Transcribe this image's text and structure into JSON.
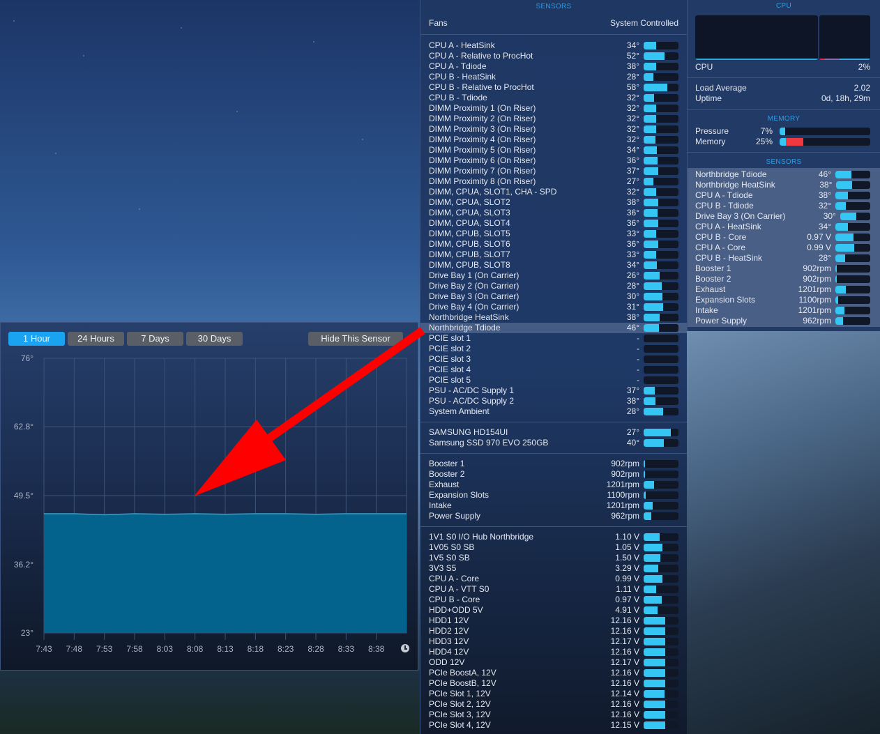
{
  "colors": {
    "accent": "#2a9de8",
    "bar_fill": "#35c6f4",
    "bar_track": "#101828",
    "memory_wired": "#f0393f",
    "arrow": "#ff0000",
    "chart_area": "#03638c"
  },
  "sensors_panel": {
    "title": "SENSORS",
    "fans_label": "Fans",
    "fans_mode": "System Controlled",
    "groups": [
      {
        "rows": [
          {
            "label": "CPU A - HeatSink",
            "value": "34°",
            "fill": 0.36
          },
          {
            "label": "CPU A - Relative to ProcHot",
            "value": "52°",
            "fill": 0.6
          },
          {
            "label": "CPU A - Tdiode",
            "value": "38°",
            "fill": 0.36
          },
          {
            "label": "CPU B - HeatSink",
            "value": "28°",
            "fill": 0.28
          },
          {
            "label": "CPU B - Relative to ProcHot",
            "value": "58°",
            "fill": 0.68
          },
          {
            "label": "CPU B - Tdiode",
            "value": "32°",
            "fill": 0.3
          },
          {
            "label": "DIMM Proximity 1 (On Riser)",
            "value": "32°",
            "fill": 0.36
          },
          {
            "label": "DIMM Proximity 2 (On Riser)",
            "value": "32°",
            "fill": 0.36
          },
          {
            "label": "DIMM Proximity 3 (On Riser)",
            "value": "32°",
            "fill": 0.36
          },
          {
            "label": "DIMM Proximity 4 (On Riser)",
            "value": "32°",
            "fill": 0.34
          },
          {
            "label": "DIMM Proximity 5 (On Riser)",
            "value": "34°",
            "fill": 0.38
          },
          {
            "label": "DIMM Proximity 6 (On Riser)",
            "value": "36°",
            "fill": 0.4
          },
          {
            "label": "DIMM Proximity 7 (On Riser)",
            "value": "37°",
            "fill": 0.42
          },
          {
            "label": "DIMM Proximity 8 (On Riser)",
            "value": "27°",
            "fill": 0.28
          },
          {
            "label": "DIMM, CPUA, SLOT1, CHA - SPD",
            "value": "32°",
            "fill": 0.36
          },
          {
            "label": "DIMM, CPUA, SLOT2",
            "value": "38°",
            "fill": 0.42
          },
          {
            "label": "DIMM, CPUA, SLOT3",
            "value": "36°",
            "fill": 0.4
          },
          {
            "label": "DIMM, CPUA, SLOT4",
            "value": "36°",
            "fill": 0.42
          },
          {
            "label": "DIMM, CPUB, SLOT5",
            "value": "33°",
            "fill": 0.36
          },
          {
            "label": "DIMM, CPUB, SLOT6",
            "value": "36°",
            "fill": 0.42
          },
          {
            "label": "DIMM, CPUB, SLOT7",
            "value": "33°",
            "fill": 0.36
          },
          {
            "label": "DIMM, CPUB, SLOT8",
            "value": "34°",
            "fill": 0.38
          },
          {
            "label": "Drive Bay 1 (On Carrier)",
            "value": "26°",
            "fill": 0.46
          },
          {
            "label": "Drive Bay 2 (On Carrier)",
            "value": "28°",
            "fill": 0.52
          },
          {
            "label": "Drive Bay 3 (On Carrier)",
            "value": "30°",
            "fill": 0.54
          },
          {
            "label": "Drive Bay 4 (On Carrier)",
            "value": "31°",
            "fill": 0.56
          },
          {
            "label": "Northbridge HeatSink",
            "value": "38°",
            "fill": 0.46
          },
          {
            "label": "Northbridge Tdiode",
            "value": "46°",
            "fill": 0.44,
            "selected": true
          },
          {
            "label": "PCIE slot 1",
            "value": "-",
            "fill": 0
          },
          {
            "label": "PCIE slot 2",
            "value": "-",
            "fill": 0
          },
          {
            "label": "PCIE slot 3",
            "value": "-",
            "fill": 0
          },
          {
            "label": "PCIE slot 4",
            "value": "-",
            "fill": 0
          },
          {
            "label": "PCIE slot 5",
            "value": "-",
            "fill": 0
          },
          {
            "label": "PSU - AC/DC Supply 1",
            "value": "37°",
            "fill": 0.32
          },
          {
            "label": "PSU - AC/DC Supply 2",
            "value": "38°",
            "fill": 0.34
          },
          {
            "label": "System Ambient",
            "value": "28°",
            "fill": 0.56
          }
        ]
      },
      {
        "rows": [
          {
            "label": "SAMSUNG HD154UI",
            "value": "27°",
            "fill": 0.77
          },
          {
            "label": "Samsung SSD 970 EVO 250GB",
            "value": "40°",
            "fill": 0.58
          }
        ]
      },
      {
        "rows": [
          {
            "label": "Booster 1",
            "value": "902rpm",
            "fill": 0.04
          },
          {
            "label": "Booster 2",
            "value": "902rpm",
            "fill": 0.04
          },
          {
            "label": "Exhaust",
            "value": "1201rpm",
            "fill": 0.3
          },
          {
            "label": "Expansion Slots",
            "value": "1100rpm",
            "fill": 0.05
          },
          {
            "label": "Intake",
            "value": "1201rpm",
            "fill": 0.26
          },
          {
            "label": "Power Supply",
            "value": "962rpm",
            "fill": 0.22
          }
        ]
      },
      {
        "rows": [
          {
            "label": "1V1 S0 I/O Hub Northbridge",
            "value": "1.10 V",
            "fill": 0.46
          },
          {
            "label": "1V05 S0 SB",
            "value": "1.05 V",
            "fill": 0.54
          },
          {
            "label": "1V5 S0 SB",
            "value": "1.50 V",
            "fill": 0.48
          },
          {
            "label": "3V3 S5",
            "value": "3.29 V",
            "fill": 0.42
          },
          {
            "label": "CPU A - Core",
            "value": "0.99 V",
            "fill": 0.54
          },
          {
            "label": "CPU A - VTT S0",
            "value": "1.11 V",
            "fill": 0.36
          },
          {
            "label": "CPU B - Core",
            "value": "0.97 V",
            "fill": 0.52
          },
          {
            "label": "HDD+ODD 5V",
            "value": "4.91 V",
            "fill": 0.4
          },
          {
            "label": "HDD1 12V",
            "value": "12.16 V",
            "fill": 0.62
          },
          {
            "label": "HDD2 12V",
            "value": "12.16 V",
            "fill": 0.62
          },
          {
            "label": "HDD3 12V",
            "value": "12.17 V",
            "fill": 0.62
          },
          {
            "label": "HDD4 12V",
            "value": "12.16 V",
            "fill": 0.62
          },
          {
            "label": "ODD 12V",
            "value": "12.17 V",
            "fill": 0.62
          },
          {
            "label": "PCIe BoostA, 12V",
            "value": "12.16 V",
            "fill": 0.62
          },
          {
            "label": "PCIe BoostB, 12V",
            "value": "12.16 V",
            "fill": 0.62
          },
          {
            "label": "PCIe Slot 1, 12V",
            "value": "12.14 V",
            "fill": 0.6
          },
          {
            "label": "PCIe Slot 2, 12V",
            "value": "12.16 V",
            "fill": 0.62
          },
          {
            "label": "PCIe Slot 3, 12V",
            "value": "12.16 V",
            "fill": 0.62
          },
          {
            "label": "PCIe Slot 4, 12V",
            "value": "12.15 V",
            "fill": 0.62
          }
        ]
      }
    ]
  },
  "right_panel": {
    "cpu_title": "CPU",
    "cpu_label": "CPU",
    "cpu_value": "2%",
    "load_label": "Load Average",
    "load_value": "2.02",
    "uptime_label": "Uptime",
    "uptime_value": "0d, 18h, 29m",
    "memory_title": "MEMORY",
    "pressure_label": "Pressure",
    "pressure_value": "7%",
    "pressure_fill": 0.06,
    "memory_label": "Memory",
    "memory_value": "25%",
    "memory_app_fill": 0.07,
    "memory_wired_fill": 0.19,
    "sensors_title": "SENSORS",
    "rows": [
      {
        "label": "Northbridge Tdiode",
        "value": "46°",
        "fill": 0.45
      },
      {
        "label": "Northbridge HeatSink",
        "value": "38°",
        "fill": 0.46
      },
      {
        "label": "CPU A - Tdiode",
        "value": "38°",
        "fill": 0.36
      },
      {
        "label": "CPU B - Tdiode",
        "value": "32°",
        "fill": 0.3
      },
      {
        "label": "Drive Bay 3 (On Carrier)",
        "value": "30°",
        "fill": 0.54
      },
      {
        "label": "CPU A - HeatSink",
        "value": "34°",
        "fill": 0.36
      },
      {
        "label": "CPU B - Core",
        "value": "0.97 V",
        "fill": 0.52
      },
      {
        "label": "CPU A - Core",
        "value": "0.99 V",
        "fill": 0.54
      },
      {
        "label": "CPU B - HeatSink",
        "value": "28°",
        "fill": 0.28
      },
      {
        "label": "Booster 1",
        "value": "902rpm",
        "fill": 0.03
      },
      {
        "label": "Booster 2",
        "value": "902rpm",
        "fill": 0.03
      },
      {
        "label": "Exhaust",
        "value": "1201rpm",
        "fill": 0.3
      },
      {
        "label": "Expansion Slots",
        "value": "1100rpm",
        "fill": 0.07
      },
      {
        "label": "Intake",
        "value": "1201rpm",
        "fill": 0.26
      },
      {
        "label": "Power Supply",
        "value": "962rpm",
        "fill": 0.22
      }
    ]
  },
  "chart_panel": {
    "ranges": [
      {
        "label": "1 Hour",
        "active": true
      },
      {
        "label": "24 Hours"
      },
      {
        "label": "7 Days"
      },
      {
        "label": "30 Days"
      }
    ],
    "hide_label": "Hide This Sensor"
  },
  "chart_data": {
    "type": "area",
    "title": "",
    "xlabel": "",
    "ylabel": "",
    "ylim": [
      23,
      76
    ],
    "y_ticks": [
      "76°",
      "62.8°",
      "49.5°",
      "36.2°",
      "23°"
    ],
    "y_tick_values": [
      76,
      62.8,
      49.5,
      36.2,
      23
    ],
    "x_ticks": [
      "7:43",
      "7:48",
      "7:53",
      "7:58",
      "8:03",
      "8:08",
      "8:13",
      "8:18",
      "8:23",
      "8:28",
      "8:33",
      "8:38"
    ],
    "x_range_minutes": [
      "7:43",
      "8:43"
    ],
    "series": [
      {
        "x": [
          "7:43",
          "7:48",
          "7:53",
          "7:58",
          "8:03",
          "8:08",
          "8:13",
          "8:18",
          "8:23",
          "8:28",
          "8:33",
          "8:38",
          "8:43"
        ],
        "values": [
          46,
          46,
          45.8,
          46,
          45.9,
          46,
          45.9,
          46,
          46,
          45.9,
          46,
          46,
          46
        ]
      }
    ],
    "grid": true
  }
}
